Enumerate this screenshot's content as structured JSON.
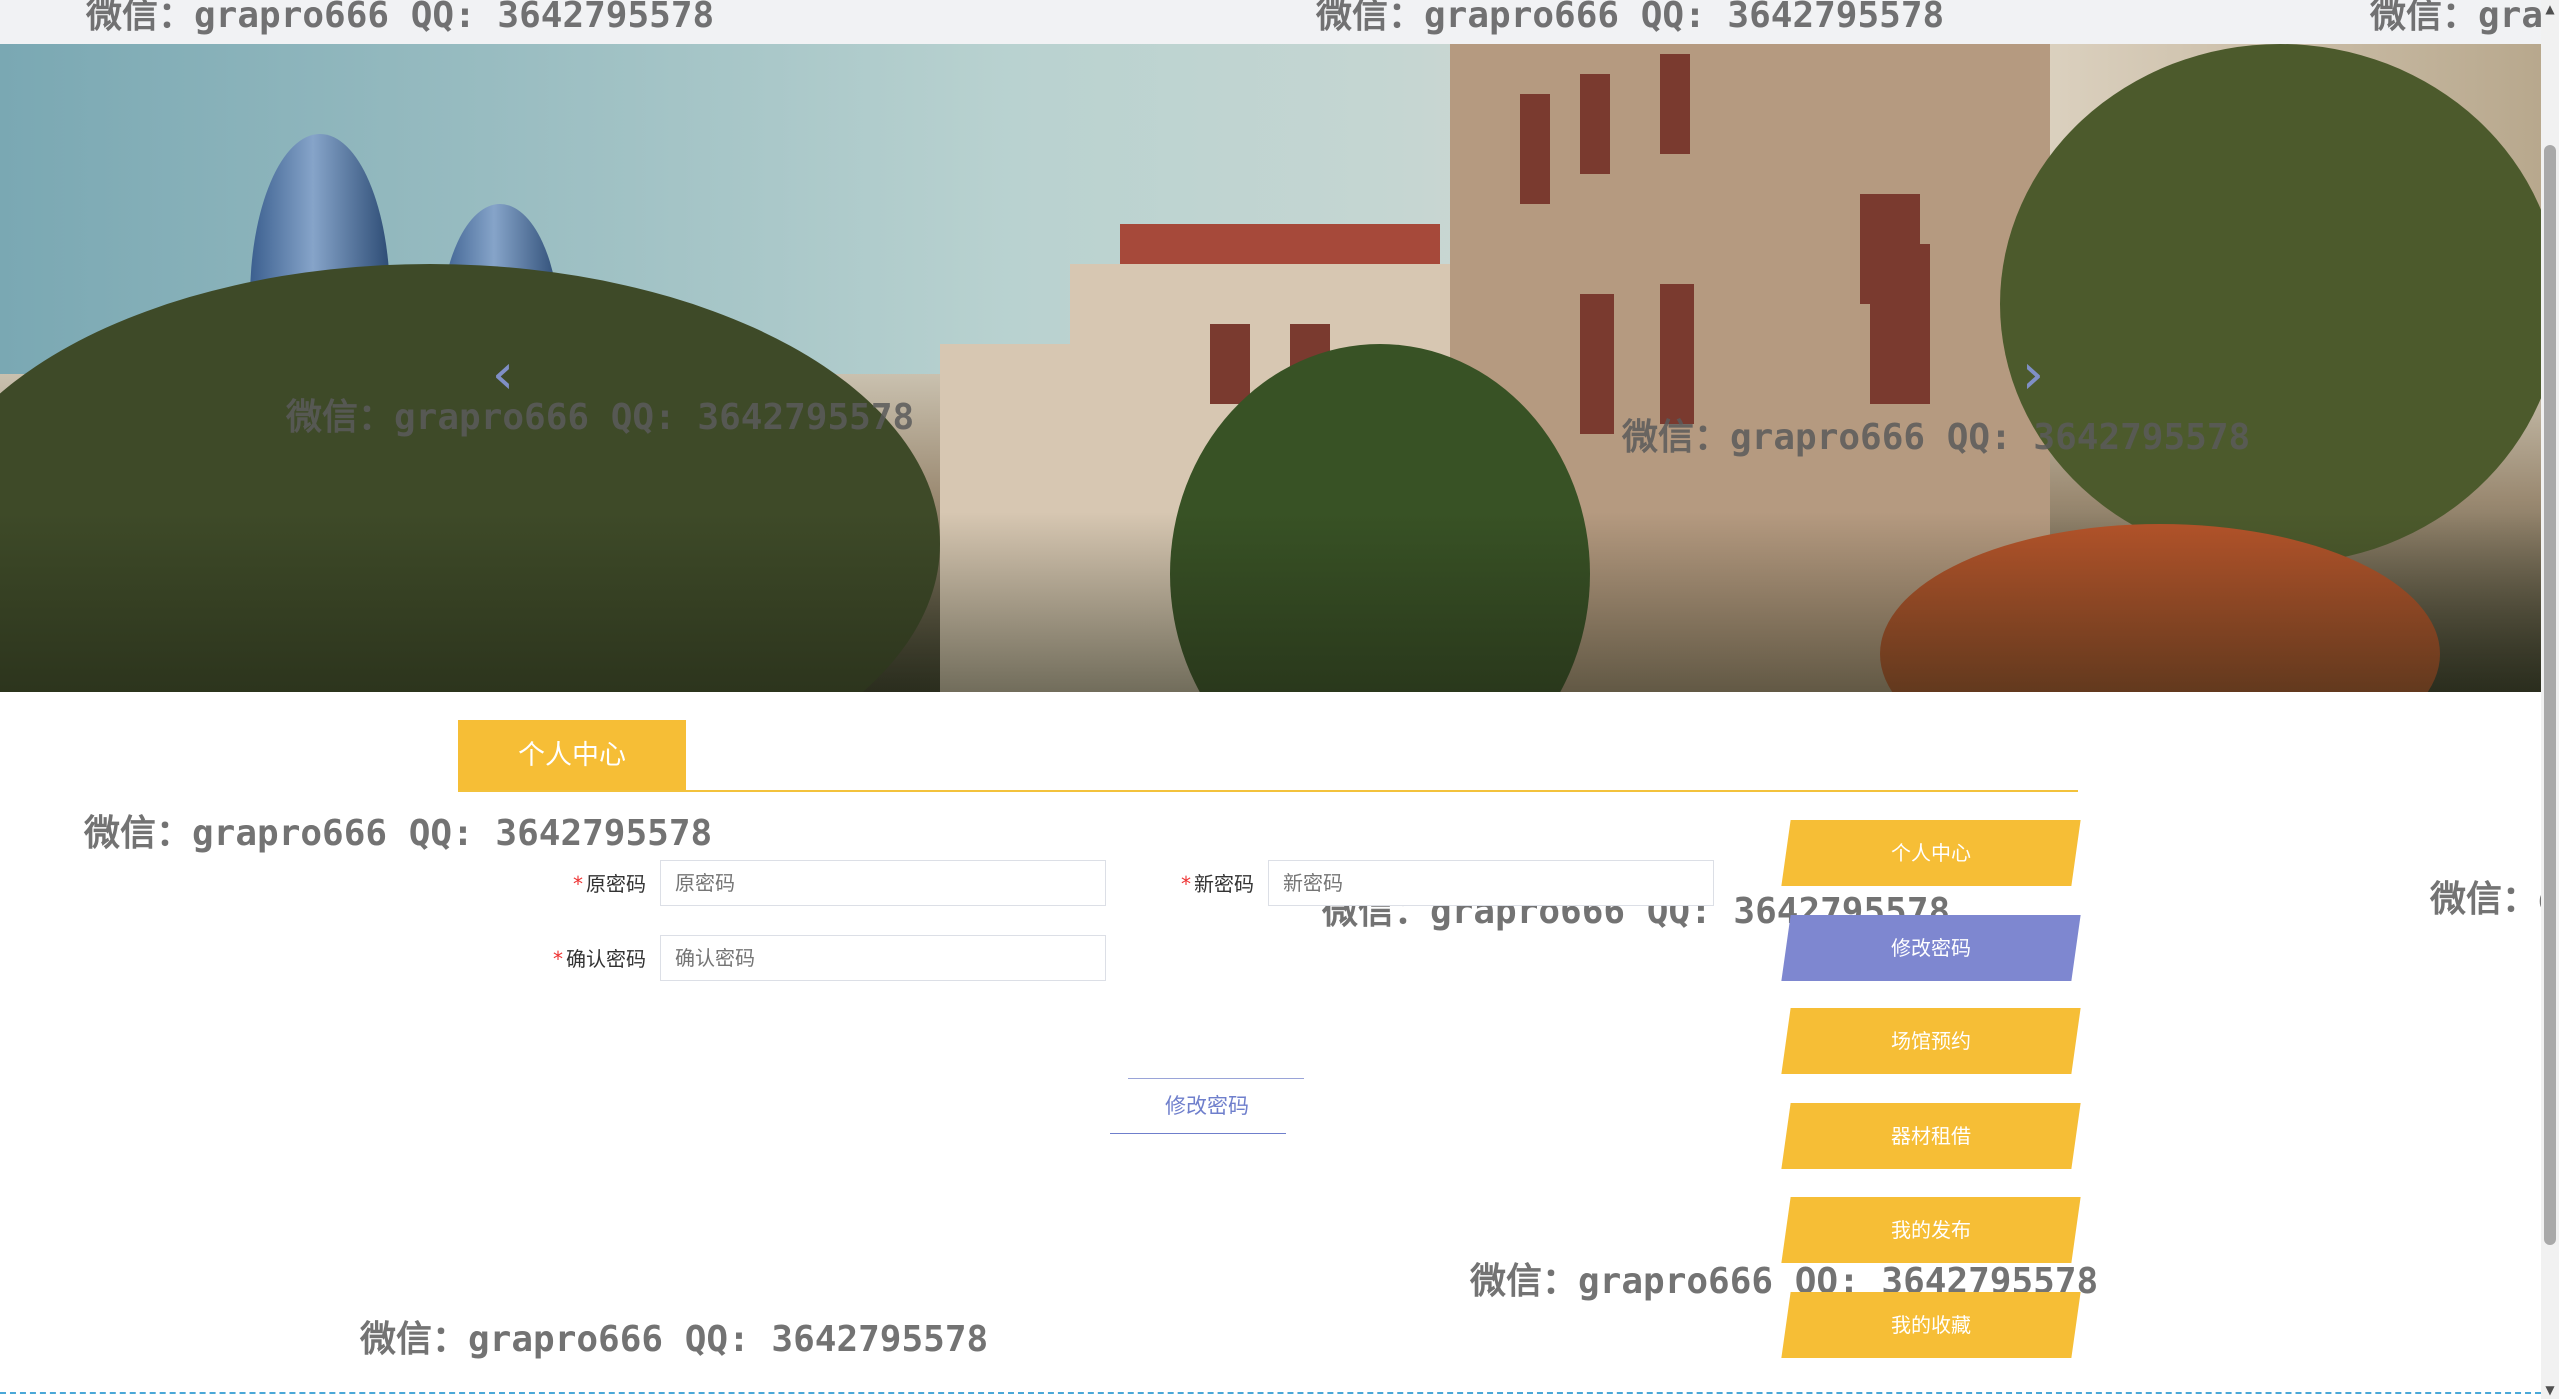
{
  "watermark": "微信：grapro666 QQ: 3642795578",
  "banner": {
    "prev": "‹",
    "next": "›"
  },
  "tab": {
    "label": "个人中心"
  },
  "form": {
    "old_password": {
      "label": "原密码",
      "placeholder": "原密码"
    },
    "new_password": {
      "label": "新密码",
      "placeholder": "新密码"
    },
    "confirm_password": {
      "label": "确认密码",
      "placeholder": "确认密码"
    },
    "required_mark": "*",
    "submit_label": "修改密码"
  },
  "sidebar": {
    "items": [
      {
        "label": "个人中心"
      },
      {
        "label": "修改密码"
      },
      {
        "label": "场馆预约"
      },
      {
        "label": "器材租借"
      },
      {
        "label": "我的发布"
      },
      {
        "label": "我的收藏"
      }
    ]
  },
  "colors": {
    "accent": "#f6be36",
    "active": "#7e87d0",
    "link": "#6f7fcc"
  },
  "scrollbar": {
    "up": "▲",
    "down": "▼"
  }
}
